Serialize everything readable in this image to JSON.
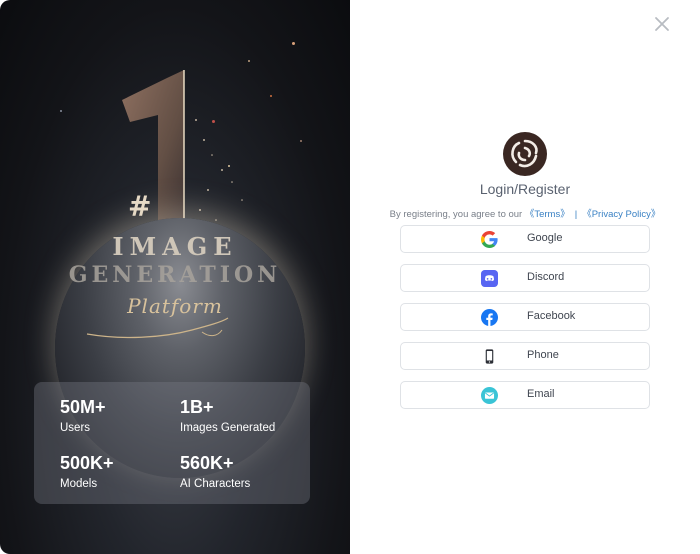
{
  "promo": {
    "rank_prefix": "#",
    "heading_line1": "IMAGE",
    "heading_line2": "GENERATION",
    "heading_script": "Platform",
    "stats": [
      {
        "value": "50M+",
        "label": "Users"
      },
      {
        "value": "1B+",
        "label": "Images Generated"
      },
      {
        "value": "500K+",
        "label": "Models"
      },
      {
        "value": "560K+",
        "label": "AI Characters"
      }
    ]
  },
  "auth": {
    "title": "Login/Register",
    "agree_text": "By registering, you agree to our",
    "terms_link": "《Terms》",
    "separator": "|",
    "privacy_link": "《Privacy Policy》",
    "providers": [
      {
        "label": "Google",
        "icon": "google-icon"
      },
      {
        "label": "Discord",
        "icon": "discord-icon"
      },
      {
        "label": "Facebook",
        "icon": "facebook-icon"
      },
      {
        "label": "Phone",
        "icon": "phone-icon"
      },
      {
        "label": "Email",
        "icon": "email-icon"
      }
    ]
  },
  "colors": {
    "link": "#3b82c4",
    "discord": "#5865F2",
    "facebook": "#1877F2",
    "email": "#3ac4d6"
  }
}
